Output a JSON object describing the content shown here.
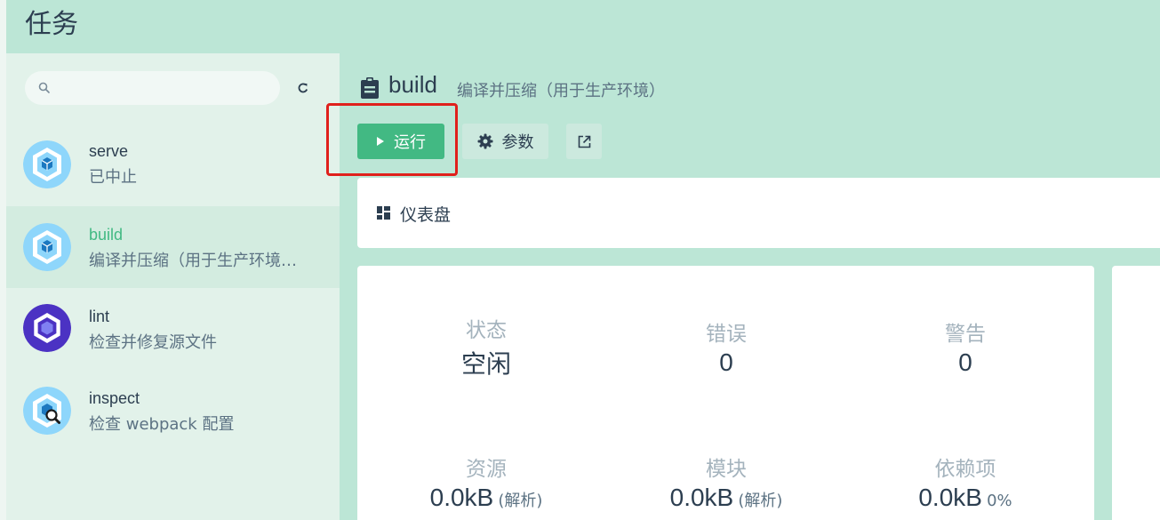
{
  "header": {
    "title": "任务"
  },
  "sidebar": {
    "search": {
      "placeholder": ""
    },
    "tasks": [
      {
        "name": "serve",
        "description": "已中止",
        "icon": "webpack-icon"
      },
      {
        "name": "build",
        "description": "编译并压缩（用于生产环境…",
        "icon": "webpack-icon",
        "selected": true
      },
      {
        "name": "lint",
        "description": "检查并修复源文件",
        "icon": "eslint-icon"
      },
      {
        "name": "inspect",
        "description": "检查 webpack 配置",
        "icon": "webpack-inspect-icon"
      }
    ]
  },
  "task": {
    "name": "build",
    "description": "编译并压缩（用于生产环境）",
    "run_label": "运行",
    "params_label": "参数"
  },
  "dashboard": {
    "label": "仪表盘",
    "stats": {
      "status": {
        "label": "状态",
        "value": "空闲"
      },
      "errors": {
        "label": "错误",
        "value": "0"
      },
      "warnings": {
        "label": "警告",
        "value": "0"
      },
      "assets": {
        "label": "资源",
        "value": "0.0kB",
        "note": "(解析)"
      },
      "modules": {
        "label": "模块",
        "value": "0.0kB",
        "note": "(解析)"
      },
      "dependencies": {
        "label": "依赖项",
        "value": "0.0kB",
        "note": "0%"
      }
    }
  },
  "colors": {
    "accent": "#42b983",
    "header_bg": "#bce6d6",
    "sidebar_bg": "#e2f2ea",
    "highlight": "#e0201c"
  }
}
